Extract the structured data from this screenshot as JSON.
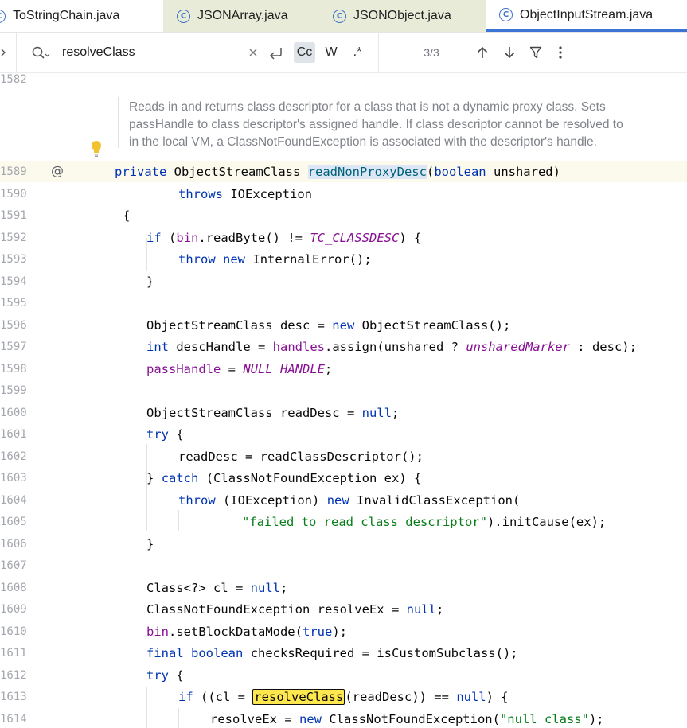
{
  "tabs": [
    {
      "label": "ToStringChain.java",
      "icon": "class-icon",
      "active": false
    },
    {
      "label": "JSONArray.java",
      "icon": "class-icon",
      "active": false
    },
    {
      "label": "JSONObject.java",
      "icon": "class-icon",
      "active": false
    },
    {
      "label": "ObjectInputStream.java",
      "icon": "class-icon",
      "active": true
    }
  ],
  "search": {
    "query": "resolveClass",
    "match_case_label": "Cc",
    "words_label": "W",
    "regex_label": ".*",
    "counter": "3/3"
  },
  "editor": {
    "javadoc": [
      "Reads in and returns class descriptor for a class that is not a dynamic proxy class. Sets",
      "passHandle to class descriptor's assigned handle. If class descriptor cannot be resolved to",
      "in the local VM, a ClassNotFoundException is associated with the descriptor's handle."
    ],
    "javadoc_line_number": "1582",
    "lines": [
      {
        "n": "1589"
      },
      {
        "n": "1590"
      },
      {
        "n": "1591"
      },
      {
        "n": "1592"
      },
      {
        "n": "1593"
      },
      {
        "n": "1594"
      },
      {
        "n": "1595"
      },
      {
        "n": "1596"
      },
      {
        "n": "1597"
      },
      {
        "n": "1598"
      },
      {
        "n": "1599"
      },
      {
        "n": "1600"
      },
      {
        "n": "1601"
      },
      {
        "n": "1602"
      },
      {
        "n": "1603"
      },
      {
        "n": "1604"
      },
      {
        "n": "1605"
      },
      {
        "n": "1606"
      },
      {
        "n": "1607"
      },
      {
        "n": "1608"
      },
      {
        "n": "1609"
      },
      {
        "n": "1610"
      },
      {
        "n": "1611"
      },
      {
        "n": "1612"
      },
      {
        "n": "1613"
      },
      {
        "n": "1614"
      }
    ],
    "code": {
      "l1589": {
        "a": "private",
        "b": "ObjectStreamClass",
        "c": "readNonProxyDesc",
        "d": "(",
        "e": "boolean",
        "f": "unshared)"
      },
      "l1590": {
        "a": "throws",
        "b": "IOException"
      },
      "l1591": {
        "a": "{"
      },
      "l1592": {
        "a": "if",
        "b": "(",
        "c": "bin",
        "d": ".readByte() != ",
        "e": "TC_CLASSDESC",
        "f": ") {"
      },
      "l1593": {
        "a": "throw",
        "b": "new",
        "c": "InternalError();"
      },
      "l1594": {
        "a": "}"
      },
      "l1596": {
        "a": "ObjectStreamClass desc = ",
        "b": "new",
        "c": "ObjectStreamClass();"
      },
      "l1597": {
        "a": "int",
        "b": "descHandle = ",
        "c": "handles",
        "d": ".assign(unshared ? ",
        "e": "unsharedMarker",
        "f": " : desc);"
      },
      "l1598": {
        "a": "passHandle",
        "b": " = ",
        "c": "NULL_HANDLE",
        "d": ";"
      },
      "l1600": {
        "a": "ObjectStreamClass readDesc = ",
        "b": "null",
        "c": ";"
      },
      "l1601": {
        "a": "try",
        "b": "{"
      },
      "l1602": {
        "a": "readDesc = readClassDescriptor();"
      },
      "l1603": {
        "a": "}",
        "b": "catch",
        "c": "(ClassNotFoundException ex) {"
      },
      "l1604": {
        "a": "throw",
        "b": "(IOException)",
        "c": "new",
        "d": "InvalidClassException("
      },
      "l1605": {
        "a": "\"failed to read class descriptor\"",
        "b": ").initCause(ex);"
      },
      "l1606": {
        "a": "}"
      },
      "l1608": {
        "a": "Class<?> cl = ",
        "b": "null",
        "c": ";"
      },
      "l1609": {
        "a": "ClassNotFoundException resolveEx = ",
        "b": "null",
        "c": ";"
      },
      "l1610": {
        "a": "bin",
        "b": ".setBlockDataMode(",
        "c": "true",
        "d": ");"
      },
      "l1611": {
        "a": "final",
        "b": "boolean",
        "c": "checksRequired = isCustomSubclass();"
      },
      "l1612": {
        "a": "try",
        "b": "{"
      },
      "l1613": {
        "a": "if",
        "b": "((cl = ",
        "c": "resolveClass",
        "d": "(readDesc)) == ",
        "e": "null",
        "f": ") {"
      },
      "l1614": {
        "a": "resolveEx = ",
        "b": "new",
        "c": "ClassNotFoundException(",
        "d": "\"null class\"",
        "e": ");"
      }
    }
  }
}
